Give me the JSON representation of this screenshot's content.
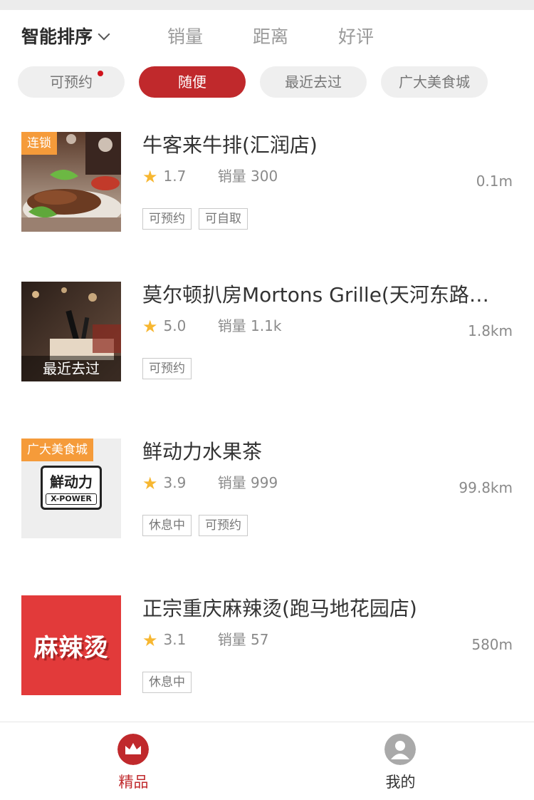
{
  "sort_tabs": [
    {
      "label": "智能排序"
    },
    {
      "label": "销量"
    },
    {
      "label": "距离"
    },
    {
      "label": "好评"
    }
  ],
  "filters": [
    {
      "label": "可预约",
      "has_dot": true
    },
    {
      "label": "随便",
      "active": true
    },
    {
      "label": "最近去过"
    },
    {
      "label": "广大美食城"
    }
  ],
  "shops": [
    {
      "name": "牛客来牛排(汇润店)",
      "rating": "1.7",
      "sales_label": "销量",
      "sales": "300",
      "distance": "0.1m",
      "ribbon": "连锁",
      "tags": [
        "可预约",
        "可自取"
      ]
    },
    {
      "name": "莫尔顿扒房Mortons Grille(天河东路…",
      "rating": "5.0",
      "sales_label": "销量",
      "sales": "1.1k",
      "distance": "1.8km",
      "bottom_tag": "最近去过",
      "tags": [
        "可预约"
      ]
    },
    {
      "name": "鲜动力水果茶",
      "rating": "3.9",
      "sales_label": "销量",
      "sales": "999",
      "distance": "99.8km",
      "ribbon": "广大美食城",
      "logo_text": "鮮动力",
      "logo_sub": "X-POWER",
      "tags": [
        "休息中",
        "可预约"
      ]
    },
    {
      "name": "正宗重庆麻辣烫(跑马地花园店)",
      "rating": "3.1",
      "sales_label": "销量",
      "sales": "57",
      "distance": "580m",
      "logo_text": "麻辣烫",
      "tags": [
        "休息中"
      ]
    }
  ],
  "tabbar": [
    {
      "label": "精品",
      "active": true,
      "icon": "crown-icon"
    },
    {
      "label": "我的",
      "icon": "user-icon"
    }
  ],
  "colors": {
    "accent": "#c0292c",
    "star": "#f7b731",
    "ribbon": "#f59b3a"
  }
}
